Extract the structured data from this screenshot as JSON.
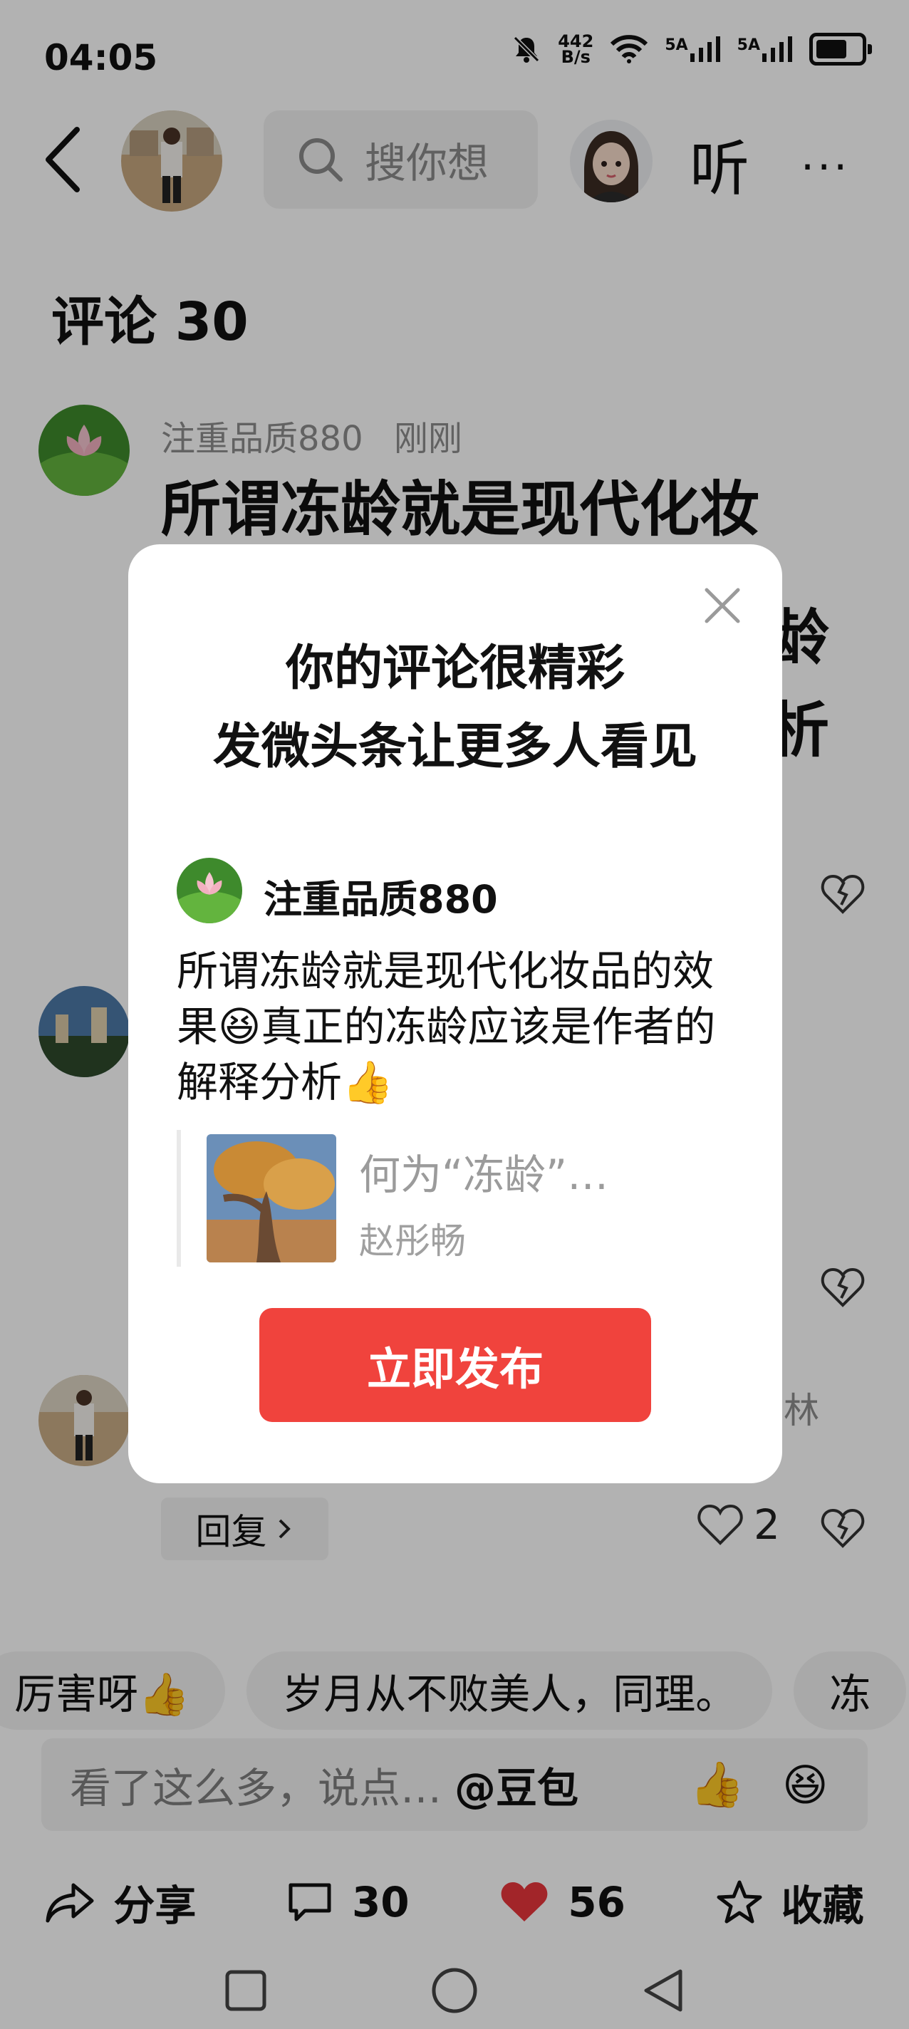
{
  "status_bar": {
    "time": "04:05",
    "net_speed_top": "442",
    "net_speed_bottom": "B/s",
    "signal1": "5A",
    "signal2": "5A"
  },
  "header": {
    "search_placeholder": "搜你想",
    "listen_label": "听",
    "more_label": "···"
  },
  "comments": {
    "title": "评论 30",
    "first": {
      "author": "注重品质880",
      "time": "刚刚",
      "text_line1": "所谓冻龄就是现代化妆"
    },
    "partial_right1": "龄",
    "partial_right2": "析",
    "partial_name_right": "林",
    "reply_label": "回复",
    "reply_like_count": "2"
  },
  "quick_chips": [
    "厉害呀👍",
    "岁月从不败美人，同理。",
    "冻"
  ],
  "input": {
    "placeholder": "看了这么多，说点…",
    "bot_label": "@豆包",
    "emoji1": "👍",
    "emoji2": "😆"
  },
  "action_bar": {
    "share_label": "分享",
    "comment_count": "30",
    "like_count": "56",
    "favorite_label": "收藏"
  },
  "modal": {
    "title_line1": "你的评论很精彩",
    "title_line2": "发微头条让更多人看见",
    "author": "注重品质880",
    "comment_text": "所谓冻龄就是现代化妆品的效果😆真正的冻龄应该是作者的解释分析👍",
    "quoted_title": "何为“冻龄”…",
    "quoted_author": "赵彤畅",
    "publish_label": "立即发布"
  },
  "colors": {
    "accent_red": "#f0433d",
    "like_red": "#e8363c",
    "overlay": "rgba(0,0,0,0.30)"
  }
}
